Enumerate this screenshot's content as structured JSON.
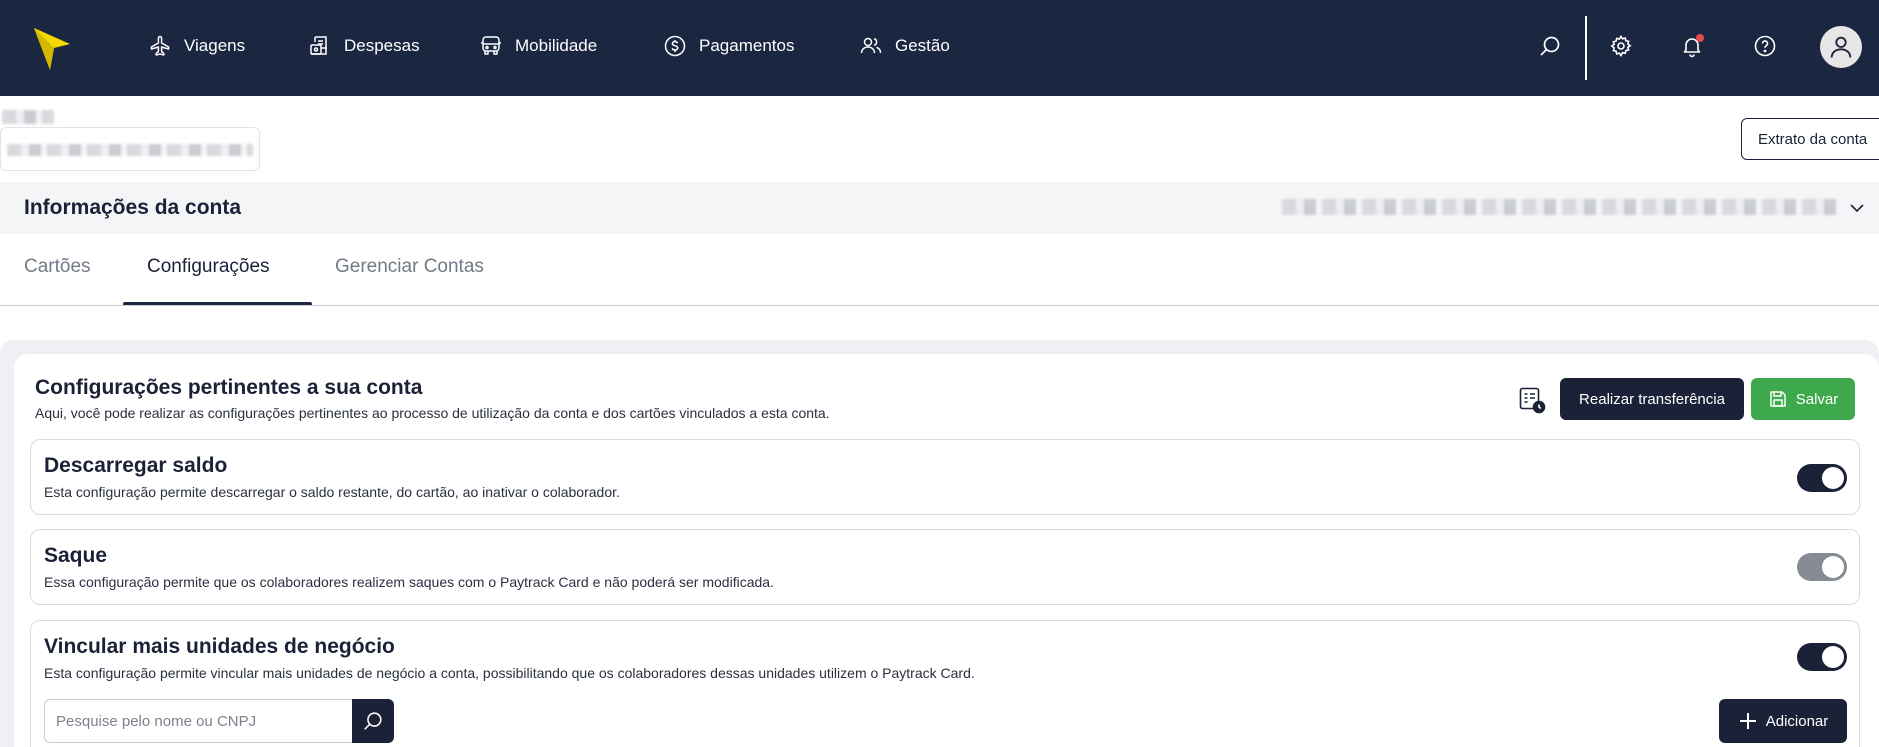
{
  "colors": {
    "navbar": "#1b2640",
    "primary": "#1b2238",
    "success": "#3ea84d",
    "logo": "#f5d800",
    "notification": "#e84a4a"
  },
  "nav": {
    "items": [
      {
        "label": "Viagens",
        "icon": "airplane-icon"
      },
      {
        "label": "Despesas",
        "icon": "receipt-icon"
      },
      {
        "label": "Mobilidade",
        "icon": "car-icon"
      },
      {
        "label": "Pagamentos",
        "icon": "dollar-coin-icon"
      },
      {
        "label": "Gestão",
        "icon": "users-icon"
      }
    ],
    "icons": [
      "search-icon",
      "gear-icon",
      "bell-icon",
      "help-icon",
      "avatar-icon"
    ]
  },
  "account": {
    "statement_button": "Extrato da conta",
    "info_title": "Informações da conta"
  },
  "tabs": [
    {
      "label": "Cartões",
      "active": false
    },
    {
      "label": "Configurações",
      "active": true
    },
    {
      "label": "Gerenciar Contas",
      "active": false
    }
  ],
  "config": {
    "title": "Configurações pertinentes a sua conta",
    "description": "Aqui, você pode realizar as configurações pertinentes ao processo de utilização da conta e dos cartões vinculados a esta conta.",
    "transfer_button": "Realizar transferência",
    "save_button": "Salvar",
    "settings": [
      {
        "title": "Descarregar saldo",
        "description": "Esta configuração permite descarregar o saldo restante, do cartão, ao inativar o colaborador.",
        "enabled": true,
        "disabled": false
      },
      {
        "title": "Saque",
        "description": "Essa configuração permite que os colaboradores realizem saques com o Paytrack Card e não poderá ser modificada.",
        "enabled": true,
        "disabled": true
      },
      {
        "title": "Vincular mais unidades de negócio",
        "description": "Esta configuração permite vincular mais unidades de negócio a conta, possibilitando que os colaboradores dessas unidades utilizem o Paytrack Card.",
        "enabled": true,
        "disabled": false
      }
    ],
    "search_placeholder": "Pesquise pelo nome ou CNPJ",
    "add_button": "Adicionar"
  }
}
